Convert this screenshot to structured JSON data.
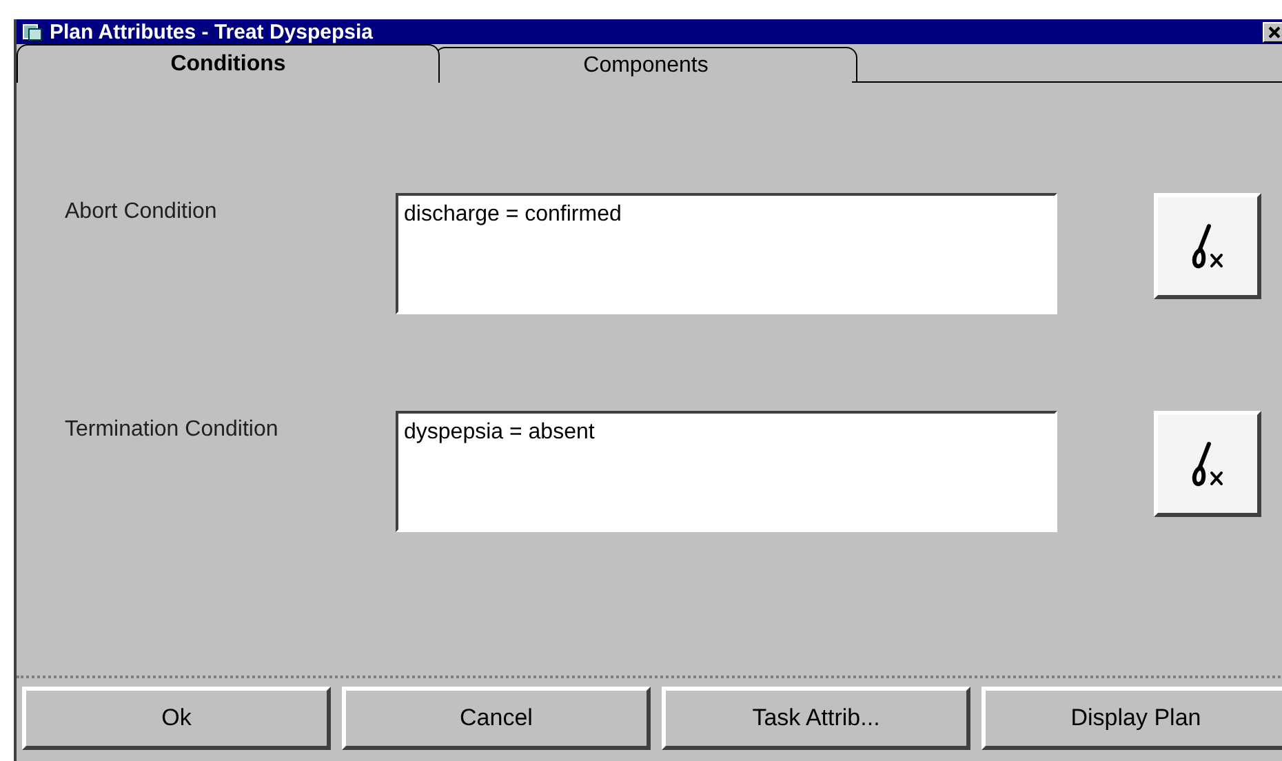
{
  "window": {
    "title": "Plan Attributes - Treat Dyspepsia"
  },
  "tabs": [
    {
      "label": "Conditions",
      "selected": true
    },
    {
      "label": "Components",
      "selected": false
    }
  ],
  "conditions": [
    {
      "label": "Abort Condition",
      "value": "discharge = confirmed"
    },
    {
      "label": "Termination Condition",
      "value": "dyspepsia = absent"
    }
  ],
  "buttons": [
    "Ok",
    "Cancel",
    "Task Attrib...",
    "Display Plan"
  ]
}
